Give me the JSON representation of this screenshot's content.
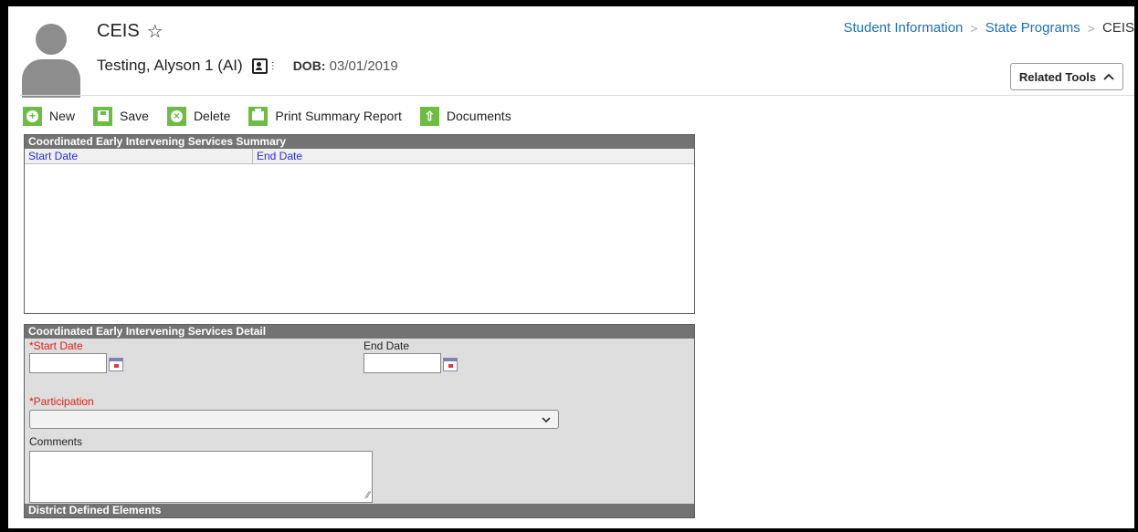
{
  "header": {
    "title": "CEIS",
    "student_name": "Testing, Alyson 1 (AI)",
    "dob_label": "DOB:",
    "dob_value": "03/01/2019"
  },
  "breadcrumb": {
    "items": [
      "Student Information",
      "State Programs",
      "CEIS"
    ]
  },
  "related_tools": {
    "label": "Related Tools",
    "icon": "chevron-up-icon"
  },
  "toolbar": {
    "items": [
      {
        "label": "New",
        "icon": "plus-icon"
      },
      {
        "label": "Save",
        "icon": "save-icon"
      },
      {
        "label": "Delete",
        "icon": "delete-icon"
      },
      {
        "label": "Print Summary Report",
        "icon": "print-icon"
      },
      {
        "label": "Documents",
        "icon": "upload-icon"
      }
    ],
    "accent_color": "#6dbd45"
  },
  "summary": {
    "title": "Coordinated Early Intervening Services Summary",
    "columns": [
      "Start Date",
      "End Date"
    ],
    "rows": []
  },
  "detail": {
    "title": "Coordinated Early Intervening Services Detail",
    "start_date_label": "*Start Date",
    "start_date_value": "",
    "end_date_label": "End Date",
    "end_date_value": "",
    "participation_label": "*Participation",
    "participation_value": "",
    "comments_label": "Comments",
    "comments_value": "",
    "district_section_title": "District Defined Elements"
  }
}
